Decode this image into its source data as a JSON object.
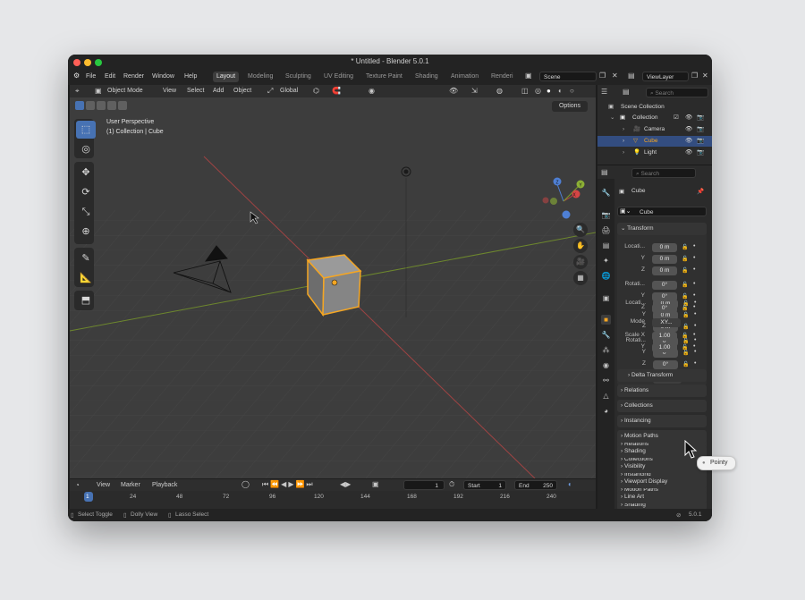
{
  "window": {
    "title": "* Untitled - Blender 5.0.1"
  },
  "menu": [
    "File",
    "Edit",
    "Render",
    "Window",
    "Help"
  ],
  "workspaces": [
    "Layout",
    "Modeling",
    "Sculpting",
    "UV Editing",
    "Texture Paint",
    "Shading",
    "Animation",
    "Renderi"
  ],
  "active_workspace": "Layout",
  "scene": {
    "label": "Scene"
  },
  "view_layer": {
    "label": "ViewLayer"
  },
  "viewport": {
    "mode": "Object Mode",
    "menus": [
      "View",
      "Select",
      "Add",
      "Object"
    ],
    "orientation": "Global",
    "options_label": "Options",
    "perspective_text": "User Perspective",
    "collection_text": "(1) Collection | Cube"
  },
  "outliner": {
    "search_placeholder": "Search",
    "scene_collection": "Scene Collection",
    "items": [
      {
        "label": "Collection",
        "icon": "collection-icon",
        "selected": false
      },
      {
        "label": "Camera",
        "icon": "camera-icon",
        "selected": false
      },
      {
        "label": "Cube",
        "icon": "mesh-icon",
        "selected": true
      },
      {
        "label": "Light",
        "icon": "light-icon",
        "selected": false
      }
    ]
  },
  "properties": {
    "search_placeholder": "Search",
    "object_name": "Cube",
    "object_field": "Cube",
    "transform_label": "Transform",
    "location_label": "Locati...",
    "rotation_label": "Rotati...",
    "mode_label": "Mode",
    "mode_value": "XY...",
    "scale_label": "Scale X",
    "axis_y": "Y",
    "axis_z": "Z",
    "location": [
      "0 m",
      "0 m",
      "0 m"
    ],
    "rotation": [
      "0°",
      "0°",
      "0°"
    ],
    "scale": [
      "1.00",
      "1.00",
      "1.00"
    ],
    "delta_transform": "Delta Transform",
    "panels": [
      "Relations",
      "Collections",
      "Instancing",
      "Motion Paths",
      "Shading",
      "Visibility",
      "Viewport Display",
      "Line Art"
    ]
  },
  "timeline": {
    "menus": [
      "View",
      "Marker",
      "Playback"
    ],
    "current_frame": "1",
    "start_label": "Start",
    "start": "1",
    "end_label": "End",
    "end": "250",
    "ticks": [
      "1",
      "24",
      "48",
      "72",
      "96",
      "120",
      "144",
      "168",
      "192",
      "216",
      "240"
    ]
  },
  "status": {
    "hints": [
      "Select Toggle",
      "Dolly View",
      "Lasso Select"
    ],
    "version": "5.0.1"
  },
  "tooltip": {
    "label": "Pointy"
  },
  "colors": {
    "accent": "#4772b3",
    "selection": "#f5a623",
    "x_axis": "#b84545",
    "y_axis": "#7a9a2a"
  }
}
